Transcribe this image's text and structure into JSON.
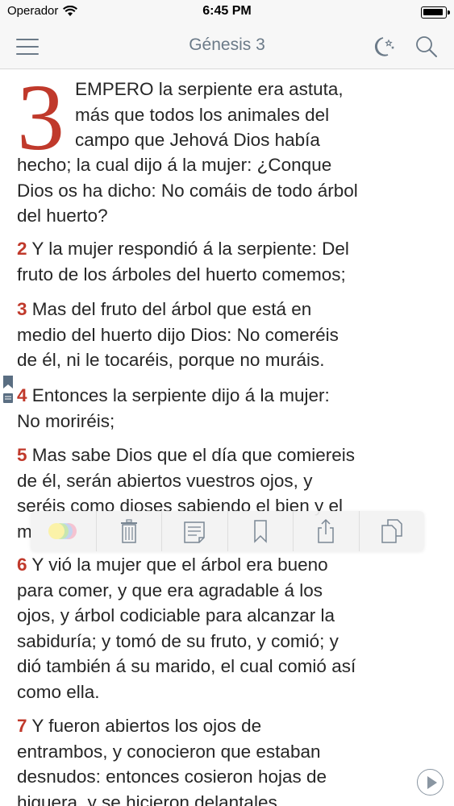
{
  "status": {
    "carrier": "Operador",
    "time": "6:45 PM"
  },
  "nav": {
    "title": "Génesis 3"
  },
  "verse1": {
    "drop_cap": "3",
    "lines_first": [
      "EMPERO la serpiente era astuta,",
      "más que todos los animales del",
      "campo que Jehová Dios había"
    ],
    "lines_rest": [
      "hecho; la cual dijo á la mujer: ¿Conque",
      "Dios os ha dicho: No comáis de todo árbol",
      "del huerto?"
    ]
  },
  "verses": [
    {
      "num": "2",
      "highlight": "none",
      "lines": [
        "Y la mujer respondió á la serpiente: Del",
        "fruto de los árboles del huerto comemos;"
      ]
    },
    {
      "num": "3",
      "highlight": "blue",
      "lines": [
        "Mas del fruto del árbol que está en",
        "medio del huerto dijo Dios: No comeréis",
        "de él, ni le tocaréis, porque no muráis."
      ]
    },
    {
      "num": "4",
      "highlight": "none",
      "lines": [
        "Entonces la serpiente dijo á la mujer:",
        "No moriréis;"
      ]
    },
    {
      "num": "5",
      "highlight": "none",
      "lines": [
        "Mas sabe Dios que el día que comiereis",
        "de él, serán abiertos vuestros ojos, y",
        "seréis como dioses sabiendo el bien y el",
        "m"
      ]
    },
    {
      "num": "6",
      "highlight": "none",
      "lines": [
        "Y vió la mujer que el árbol era bueno",
        "para comer, y que era agradable á los",
        "ojos, y árbol codiciable para alcanzar la",
        "sabiduría; y tomó de su fruto, y comió; y",
        "dió también á su marido, el cual comió así",
        "como ella."
      ]
    },
    {
      "num": "7",
      "highlight": "green",
      "lines": [
        "Y fueron abiertos los ojos de",
        "entrambos, y conocieron que estaban",
        "desnudos: entonces cosieron hojas de",
        "higuera, y se hicieron delantales."
      ]
    }
  ],
  "toolbar": {
    "tools": [
      "highlight-color-picker",
      "delete",
      "add-note",
      "bookmark",
      "share",
      "copy"
    ]
  },
  "colors": {
    "accent": "#c0392b",
    "nav_text": "#6b7a88",
    "highlight_blue": "#a0beeb",
    "highlight_green": "#aae15f"
  }
}
